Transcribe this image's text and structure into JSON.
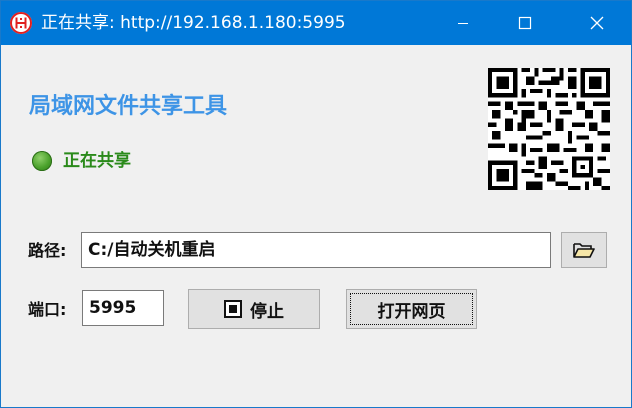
{
  "window": {
    "title": "正在共享: http://192.168.1.180:5995",
    "icon": "red-circle-logo-icon",
    "controls": [
      "minimize-icon",
      "maximize-icon",
      "close-icon"
    ]
  },
  "header": {
    "app_title": "局域网文件共享工具",
    "status_text": "正在共享",
    "status_color": "#4aa12b",
    "accent_color": "#3d94e6",
    "qr": "qr-code-icon"
  },
  "form": {
    "path_label": "路径:",
    "path_value": "C:/自动关机重启",
    "browse_icon": "folder-open-icon",
    "port_label": "端口:",
    "port_value": "5995",
    "stop_label": "停止",
    "open_label": "打开网页"
  }
}
